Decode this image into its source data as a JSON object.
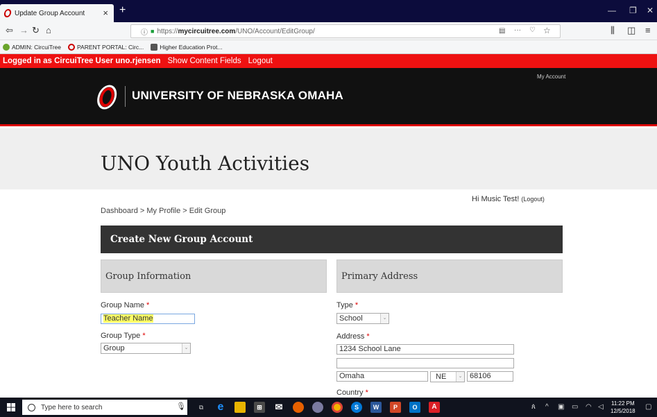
{
  "browser": {
    "tab_title": "Update Group Account",
    "url_protocol": "https://",
    "url_host": "mycircuitree.com",
    "url_path": "/UNO/Account/EditGroup/",
    "bookmarks": [
      {
        "label": "ADMIN: CircuiTree",
        "color": "#6aa52c"
      },
      {
        "label": "PARENT PORTAL: Circ...",
        "color": "#c00000"
      },
      {
        "label": "Higher Education Prot...",
        "color": "#555555"
      }
    ]
  },
  "admin_bar": {
    "logged_in_text": "Logged in as CircuiTree User uno.rjensen",
    "show_content_fields": "Show Content Fields",
    "logout": "Logout"
  },
  "header": {
    "university_name": "UNIVERSITY OF NEBRASKA OMAHA",
    "my_account": "My Account",
    "site_title": "UNO Youth Activities"
  },
  "greeting": {
    "text": "Hi Music Test!",
    "logout": "(Logout)"
  },
  "breadcrumb": "Dashboard > My Profile > Edit Group",
  "panel_title": "Create New Group Account",
  "group_info": {
    "heading": "Group Information",
    "group_name_label": "Group Name",
    "group_name_value": "Teacher Name",
    "group_type_label": "Group Type",
    "group_type_value": "Group"
  },
  "primary_address": {
    "heading": "Primary Address",
    "type_label": "Type",
    "type_value": "School",
    "address_label": "Address",
    "address_line1": "1234 School Lane",
    "address_line2": "",
    "city": "Omaha",
    "state": "NE",
    "zip": "68106",
    "country_label": "Country"
  },
  "required_marker": "*",
  "taskbar": {
    "search_placeholder": "Type here to search",
    "time": "11:22 PM",
    "date": "12/5/2018"
  },
  "colors": {
    "admin_bar": "#ee1111",
    "header_bg": "#111111",
    "panel_head": "#333333",
    "section_head": "#d9d9d9",
    "highlight": "#ffff66"
  }
}
